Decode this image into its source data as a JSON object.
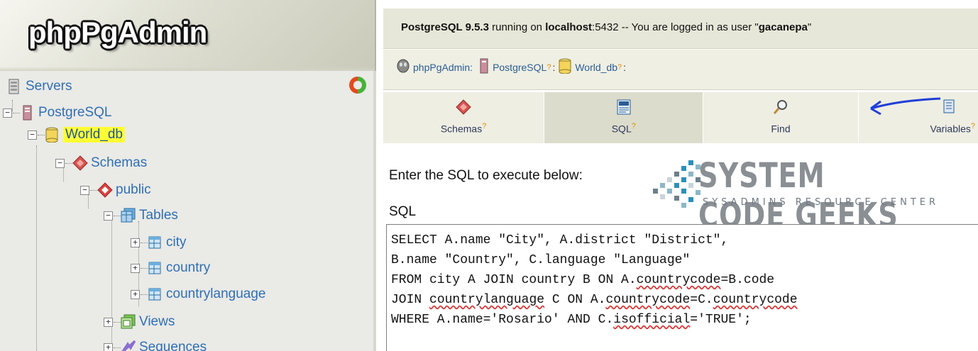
{
  "app": {
    "logo_text": "phpPgAdmin"
  },
  "tree": {
    "servers": "Servers",
    "server": "PostgreSQL",
    "database": "World_db",
    "schemas": "Schemas",
    "schema": "public",
    "tables": "Tables",
    "table_items": [
      "city",
      "country",
      "countrylanguage"
    ],
    "views": "Views",
    "sequences": "Sequences"
  },
  "topbar": {
    "product": "PostgreSQL 9.5.3",
    "running_on": " running on ",
    "host": "localhost",
    "port_text": ":5432 -- You are logged in as user \"",
    "user": "gacanepa",
    "end_quote": "\""
  },
  "breadcrumb": {
    "items": [
      "phpPgAdmin:",
      "PostgreSQL",
      "World_db"
    ],
    "help_mark": "?"
  },
  "tabs": [
    {
      "label": "Schemas",
      "help": "?"
    },
    {
      "label": "SQL",
      "help": "?"
    },
    {
      "label": "Find",
      "help": ""
    },
    {
      "label": "Variables",
      "help": "?"
    }
  ],
  "main": {
    "prompt": "Enter the SQL to execute below:",
    "sql_label": "SQL",
    "sql_lines": [
      [
        "SELECT A.name \"City\", A.district \"District\","
      ],
      [
        "B.name \"Country\", C.language \"Language\""
      ],
      [
        "FROM city A JOIN country B ON A.",
        {
          "squig": "countrycode"
        },
        "=B.code"
      ],
      [
        "JOIN ",
        {
          "squig": "countrylanguage"
        },
        " C ON A.",
        {
          "squig": "countrycode"
        },
        "=C.",
        {
          "squig": "countrycode"
        }
      ],
      [
        "WHERE A.name='Rosario' AND C.",
        {
          "squig": "isofficial"
        },
        "='TRUE';"
      ]
    ]
  },
  "watermark": {
    "title": "SYSTEM CODE GEEKS",
    "subtitle": "SYSADMINS RESOURCE CENTER"
  },
  "colors": {
    "highlight": "#ffff33",
    "link": "#2f6fb5",
    "help_mark": "#e58b00",
    "arrow": "#1f3fd6"
  }
}
